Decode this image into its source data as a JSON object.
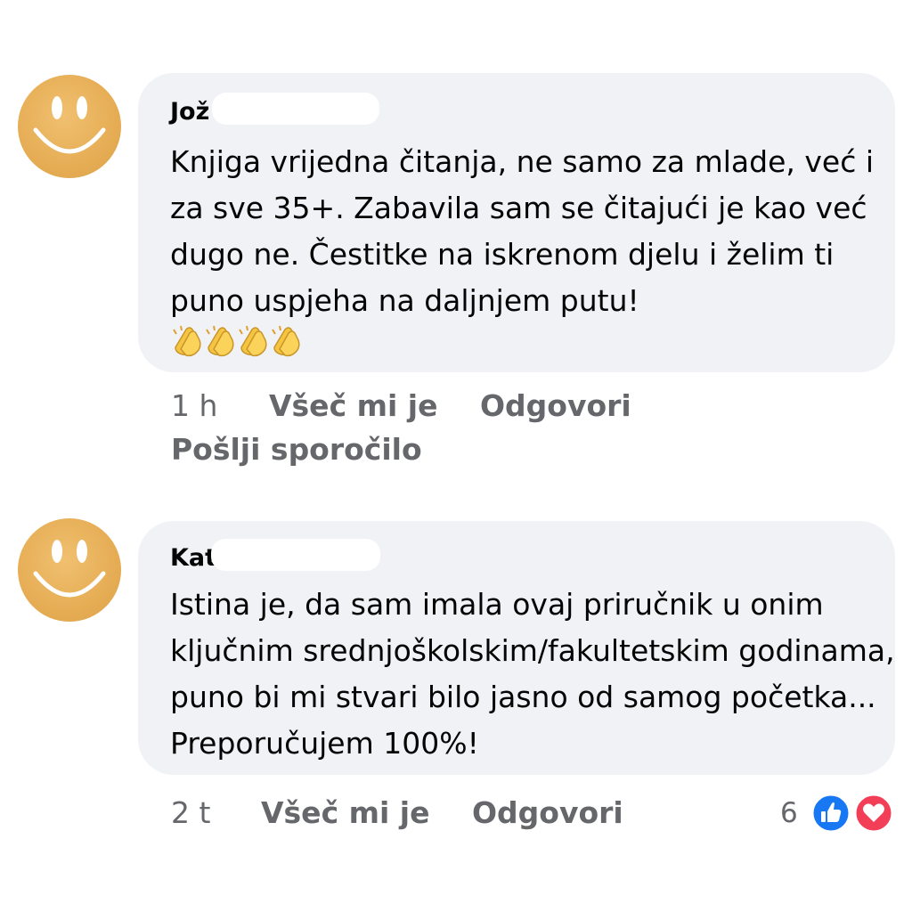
{
  "comments": [
    {
      "author_visible": "Jož",
      "text_lines": [
        "Knjiga vrijedna čitanja, ne samo za mlade, već i",
        "za sve 35+. Zabavila sam se čitajući je kao već",
        "dugo ne. Čestitke na iskrenom djelu i želim ti",
        "puno uspjeha na daljnjem putu!"
      ],
      "emoji": "👏👏👏👏",
      "time": "1 h",
      "like_label": "Všeč mi je",
      "reply_label": "Odgovori",
      "message_label": "Pošlji sporočilo"
    },
    {
      "author_visible": "Kať",
      "text_lines": [
        "Istina je, da sam imala ovaj priručnik u onim",
        "ključnim srednjoškolskim/fakultetskim godinama,",
        "puno bi mi stvari bilo jasno od samog početka...",
        "Preporučujem 100%!"
      ],
      "time": "2 t",
      "like_label": "Všeč mi je",
      "reply_label": "Odgovori",
      "reaction_count": "6",
      "reactions": [
        "like-icon",
        "love-icon"
      ]
    }
  ],
  "colors": {
    "bubble": "#f0f2f5",
    "meta_text": "#65676b",
    "avatar": "#e6ad55",
    "like_blue": "#1877f2",
    "love_red": "#f33e58"
  }
}
